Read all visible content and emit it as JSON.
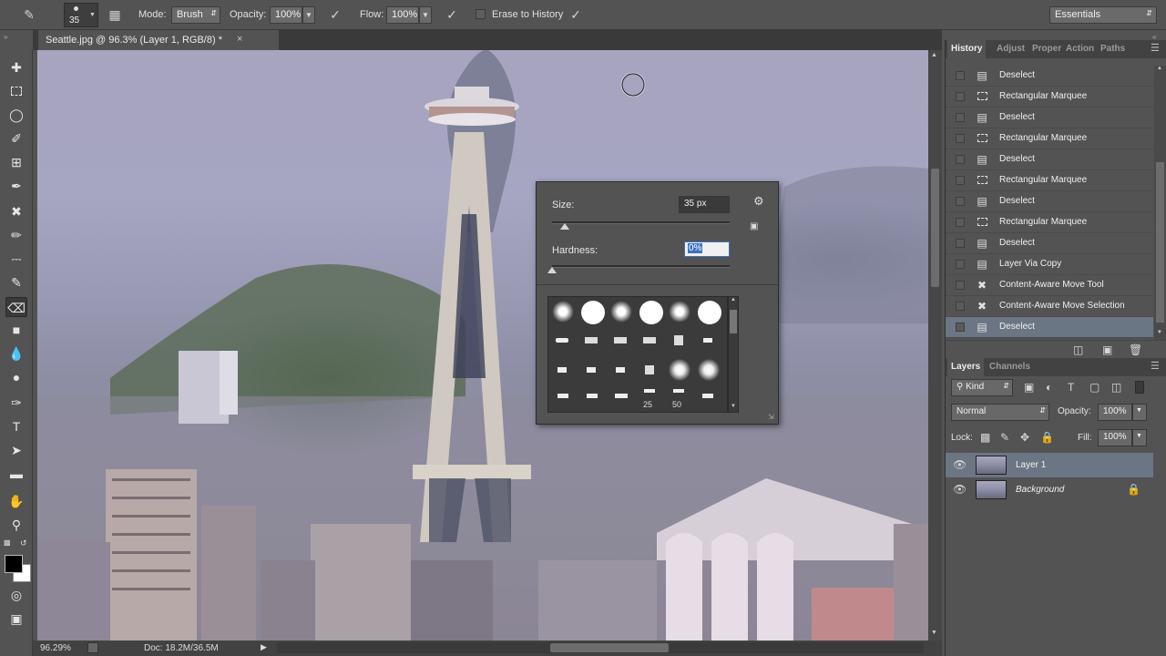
{
  "options_bar": {
    "brush_size": "35",
    "mode_label": "Mode:",
    "mode_value": "Brush",
    "opacity_label": "Opacity:",
    "opacity_value": "100%",
    "flow_label": "Flow:",
    "flow_value": "100%",
    "erase_to_history_label": "Erase to History",
    "workspace": "Essentials"
  },
  "document": {
    "tab_title": "Seattle.jpg @ 96.3% (Layer 1, RGB/8) *",
    "zoom": "96.29%",
    "doc_size": "Doc: 18.2M/36.5M"
  },
  "brush_picker": {
    "size_label": "Size:",
    "size_value": "35 px",
    "size_fraction": 0.07,
    "hardness_label": "Hardness:",
    "hardness_value": "0%",
    "hardness_fraction": 0.0,
    "presets_sizes": [
      "25",
      "50"
    ]
  },
  "history_panel": {
    "tabs": [
      "History",
      "Adjust",
      "Proper",
      "Action",
      "Paths"
    ],
    "items": [
      {
        "label": "Deselect",
        "icon": "document-icon"
      },
      {
        "label": "Rectangular Marquee",
        "icon": "marquee-icon"
      },
      {
        "label": "Deselect",
        "icon": "document-icon"
      },
      {
        "label": "Rectangular Marquee",
        "icon": "marquee-icon"
      },
      {
        "label": "Deselect",
        "icon": "document-icon"
      },
      {
        "label": "Rectangular Marquee",
        "icon": "marquee-icon"
      },
      {
        "label": "Deselect",
        "icon": "document-icon"
      },
      {
        "label": "Rectangular Marquee",
        "icon": "marquee-icon"
      },
      {
        "label": "Deselect",
        "icon": "document-icon"
      },
      {
        "label": "Layer Via Copy",
        "icon": "document-icon"
      },
      {
        "label": "Content-Aware Move Tool",
        "icon": "content-aware-move-icon"
      },
      {
        "label": "Content-Aware Move Selection",
        "icon": "content-aware-move-icon"
      },
      {
        "label": "Deselect",
        "icon": "document-icon"
      }
    ]
  },
  "layers_panel": {
    "tabs": [
      "Layers",
      "Channels"
    ],
    "filter_label": "Kind",
    "blend_mode": "Normal",
    "opacity_label": "Opacity:",
    "opacity_value": "100%",
    "lock_label": "Lock:",
    "fill_label": "Fill:",
    "fill_value": "100%",
    "layers": [
      {
        "name": "Layer 1",
        "selected": true,
        "locked": false
      },
      {
        "name": "Background",
        "selected": false,
        "locked": true
      }
    ]
  },
  "colors": {
    "foreground": "#000000",
    "background": "#ffffff",
    "selection": "#6b7684"
  }
}
